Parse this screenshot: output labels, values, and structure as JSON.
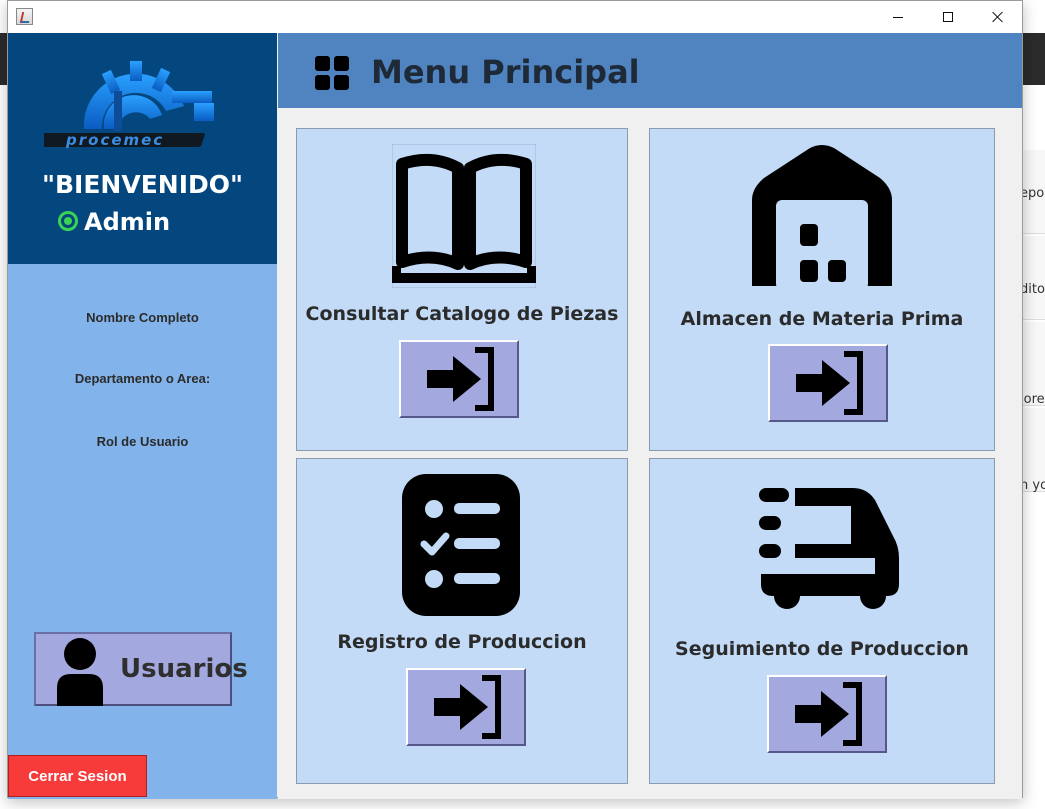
{
  "window": {
    "icon": "java-app-icon",
    "controls": {
      "minimize": "minimize-icon",
      "maximize": "maximize-icon",
      "close": "close-icon"
    }
  },
  "sidebar": {
    "logo": "procemec-logo",
    "welcome": "\"BIENVENIDO\"",
    "user_name": "Admin",
    "status_color": "#39d353",
    "info": {
      "full_name_label": "Nombre Completo",
      "department_label": "Departamento o Area:",
      "role_label": "Rol de Usuario"
    },
    "users_button": {
      "label": "Usuarios",
      "icon": "user-icon"
    },
    "logout_button": {
      "label": "Cerrar Sesion"
    }
  },
  "header": {
    "title": "Menu Principal",
    "icon": "grid-icon"
  },
  "menu": {
    "cards": [
      {
        "label": "Consultar Catalogo de Piezas",
        "icon": "book-icon",
        "action_icon": "login-arrow-icon"
      },
      {
        "label": "Almacen de Materia Prima",
        "icon": "warehouse-icon",
        "action_icon": "login-arrow-icon"
      },
      {
        "label": "Registro de Produccion",
        "icon": "checklist-icon",
        "action_icon": "login-arrow-icon"
      },
      {
        "label": "Seguimiento de Produccion",
        "icon": "delivery-truck-icon",
        "action_icon": "login-arrow-icon"
      }
    ]
  },
  "background_app": {
    "snippets": [
      "epo",
      "dito",
      "lore",
      "n yo"
    ]
  },
  "colors": {
    "sidebar_dark": "#04477f",
    "sidebar_light": "#82b3ea",
    "header": "#5084c1",
    "card": "#c3dbf7",
    "button": "#a3a8df",
    "logout": "#f73b3b"
  }
}
